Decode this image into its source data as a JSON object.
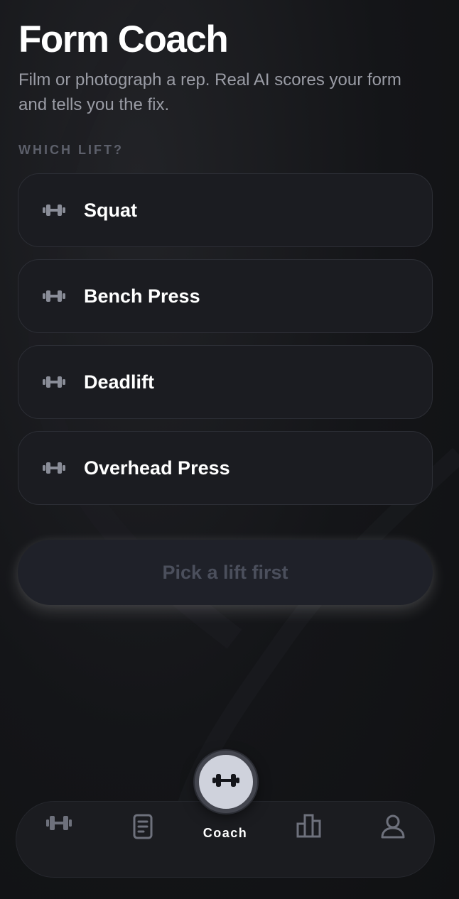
{
  "header": {
    "title": "Form Coach",
    "subtitle": "Film or photograph a rep. Real AI scores your form and tells you the fix."
  },
  "lift_section": {
    "label": "WHICH LIFT?",
    "lifts": [
      {
        "name": "Squat",
        "icon": "dumbbell-icon"
      },
      {
        "name": "Bench Press",
        "icon": "dumbbell-icon"
      },
      {
        "name": "Deadlift",
        "icon": "dumbbell-icon"
      },
      {
        "name": "Overhead Press",
        "icon": "dumbbell-icon"
      }
    ]
  },
  "cta": {
    "label": "Pick a lift first",
    "enabled": false
  },
  "tab_bar": {
    "active": "Coach",
    "tabs": [
      {
        "label": "",
        "icon": "dumbbell-icon"
      },
      {
        "label": "",
        "icon": "notebook-icon"
      },
      {
        "label": "Coach",
        "icon": "dumbbell-icon"
      },
      {
        "label": "",
        "icon": "bar-chart-icon"
      },
      {
        "label": "",
        "icon": "profile-icon"
      }
    ]
  },
  "colors": {
    "background": "#141518",
    "card": "#1b1c21",
    "card_border": "#2c2e35",
    "muted_text": "#9a9ca5",
    "label_text": "#5d606b",
    "icon_gray": "#8a8d98",
    "disabled_text": "#4b4f5c",
    "fab": "#cfd2dc"
  }
}
